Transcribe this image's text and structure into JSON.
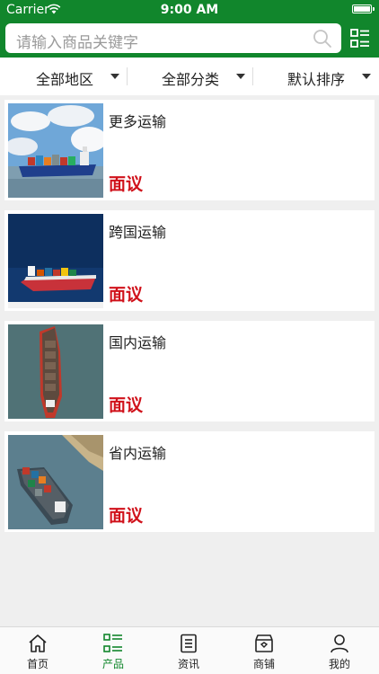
{
  "status_bar": {
    "carrier": "Carrier",
    "time": "9:00 AM"
  },
  "search": {
    "placeholder": "请输入商品关键字"
  },
  "filters": [
    {
      "label": "全部地区"
    },
    {
      "label": "全部分类"
    },
    {
      "label": "默认排序"
    }
  ],
  "products": [
    {
      "title": "更多运输",
      "price": "面议",
      "image": "cargo-ship-sea-clouds"
    },
    {
      "title": "跨国运输",
      "price": "面议",
      "image": "container-ship-dark-sea"
    },
    {
      "title": "国内运输",
      "price": "面议",
      "image": "bulk-carrier-aerial"
    },
    {
      "title": "省内运输",
      "price": "面议",
      "image": "container-ship-coast"
    }
  ],
  "tabs": [
    {
      "label": "首页",
      "icon": "home-icon"
    },
    {
      "label": "产品",
      "icon": "product-list-icon",
      "active": true
    },
    {
      "label": "资讯",
      "icon": "news-icon"
    },
    {
      "label": "商铺",
      "icon": "shop-icon"
    },
    {
      "label": "我的",
      "icon": "user-icon"
    }
  ],
  "colors": {
    "brand": "#11862c",
    "price": "#d0121b",
    "background": "#efefef"
  }
}
